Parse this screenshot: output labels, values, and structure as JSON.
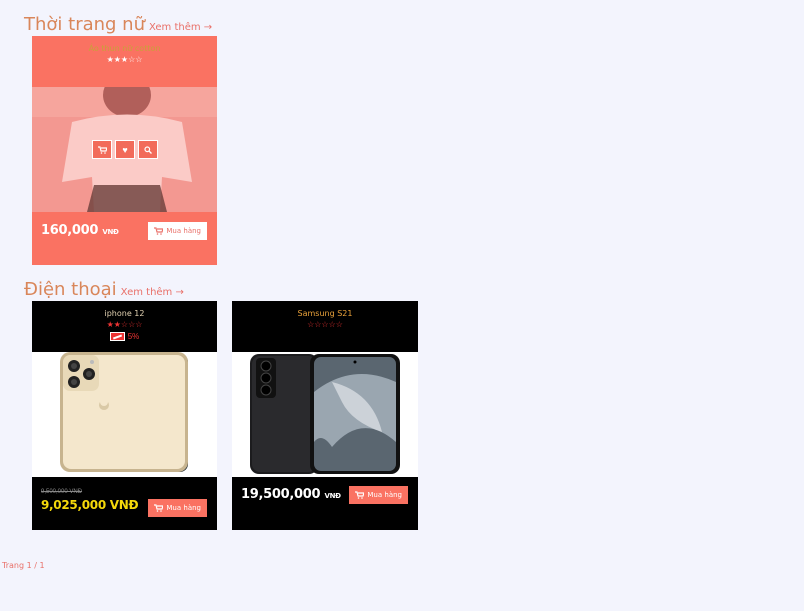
{
  "sections": [
    {
      "title": "Thời trang nữ",
      "see_more": "Xem thêm →",
      "products": [
        {
          "name": "Áo thun nữ cotton",
          "rating": 3,
          "price": "160,000",
          "currency": "VNĐ",
          "buy_label": "Mua hàng",
          "theme": "#fa7262"
        }
      ]
    },
    {
      "title": "Điện thoại",
      "see_more": "Xem thêm →",
      "products": [
        {
          "name": "iphone 12",
          "rating": 2,
          "sale_percent": "5%",
          "old_price": "9,500,000 VNĐ",
          "price": "9,025,000 VNĐ",
          "buy_label": "Mua hàng",
          "theme": "#000000"
        },
        {
          "name": "Samsung S21",
          "rating": 0,
          "price": "19,500,000",
          "currency": "VNĐ",
          "buy_label": "Mua hàng",
          "theme": "#000000"
        }
      ]
    }
  ],
  "pagination": "Trang 1 / 1",
  "colors": {
    "accent": "#fa7262",
    "heading": "#d9865a",
    "link": "#e9716a",
    "price_highlight": "#f5d90a",
    "background": "#f3f4fd"
  }
}
